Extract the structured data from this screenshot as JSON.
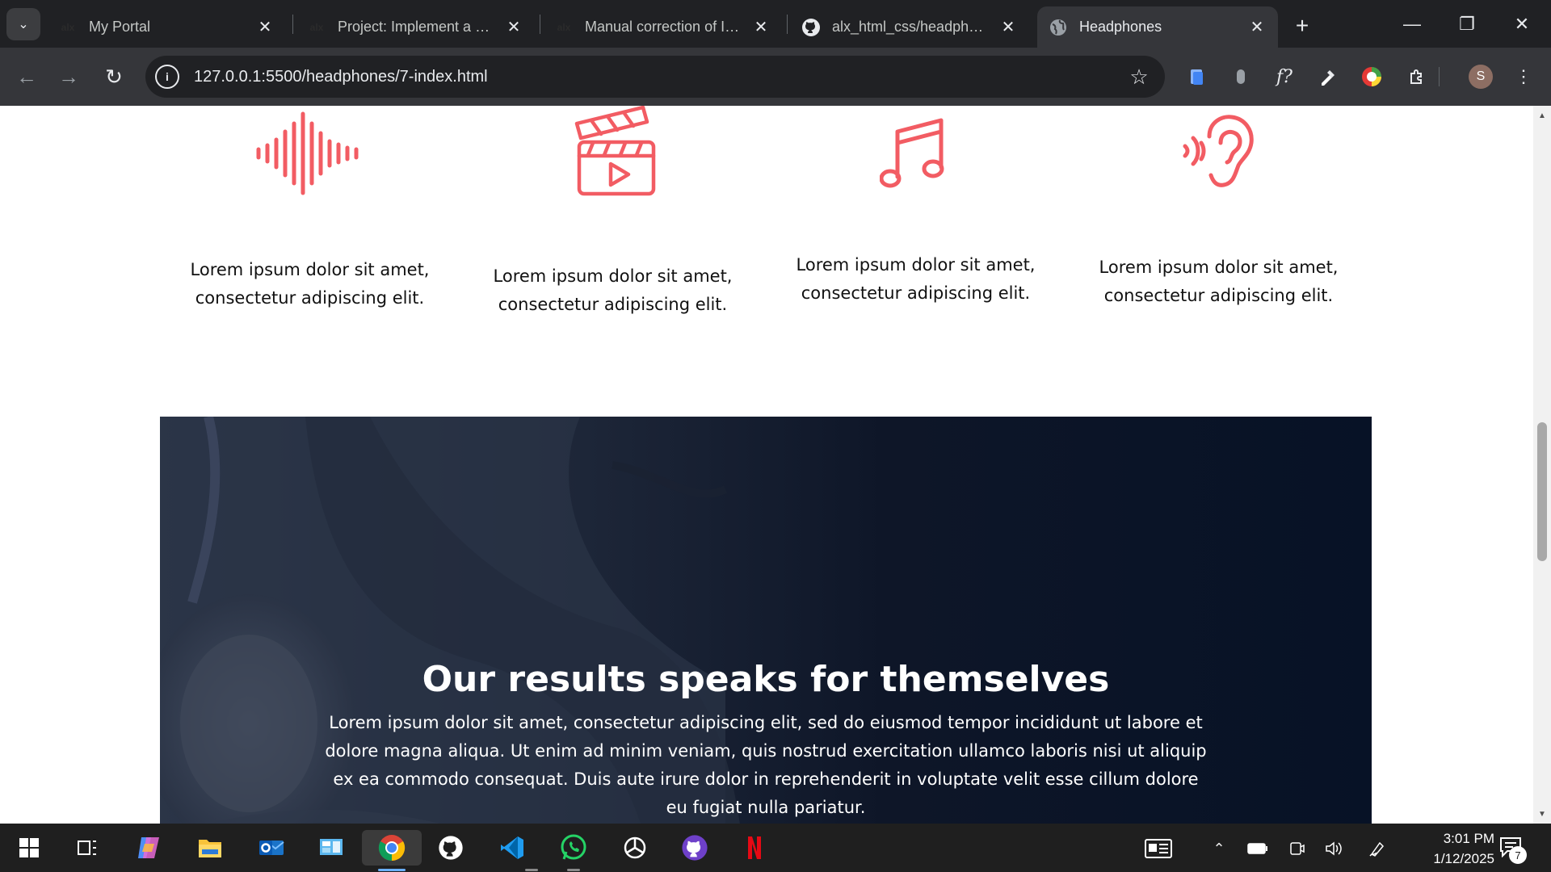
{
  "browser": {
    "tabs": [
      {
        "title": "My Portal",
        "favicon": "alx-icon",
        "active": false
      },
      {
        "title": "Project: Implement a design",
        "favicon": "alx-icon",
        "active": false
      },
      {
        "title": "Manual correction of Implement",
        "favicon": "alx-icon",
        "active": false
      },
      {
        "title": "alx_html_css/headphones",
        "favicon": "github-icon",
        "active": false
      },
      {
        "title": "Headphones",
        "favicon": "globe-icon",
        "active": true
      }
    ],
    "url": "127.0.0.1:5500/headphones/7-index.html",
    "profile_initial": "S",
    "fx_label": "f?"
  },
  "page": {
    "features": [
      {
        "icon": "sound-wave-icon",
        "text": "Lorem ipsum dolor sit amet, consectetur adipiscing elit."
      },
      {
        "icon": "movie-clapper-icon",
        "text": "Lorem ipsum dolor sit amet, consectetur adipiscing elit."
      },
      {
        "icon": "music-note-icon",
        "text": "Lorem ipsum dolor sit amet, consectetur adipiscing elit."
      },
      {
        "icon": "ear-icon",
        "text": "Lorem ipsum dolor sit amet, consectetur adipiscing elit."
      }
    ],
    "results": {
      "title": "Our results speaks for themselves",
      "body": "Lorem ipsum dolor sit amet, consectetur adipiscing elit, sed do eiusmod tempor incididunt ut labore et dolore magna aliqua. Ut enim ad minim veniam, quis nostrud exercitation ullamco laboris nisi ut aliquip ex ea commodo consequat. Duis aute irure dolor in reprehenderit in voluptate velit esse cillum dolore eu fugiat nulla pariatur."
    },
    "accent_color": "#f25c63"
  },
  "taskbar": {
    "apps": [
      "start-icon",
      "task-view-icon",
      "copilot-icon",
      "file-explorer-icon",
      "outlook-icon",
      "control-panel-icon",
      "chrome-icon",
      "github-desktop-icon",
      "vscode-icon",
      "whatsapp-icon",
      "chatgpt-icon",
      "github-icon",
      "netflix-icon"
    ],
    "time": "3:01 PM",
    "date": "1/12/2025",
    "notification_count": "7"
  }
}
